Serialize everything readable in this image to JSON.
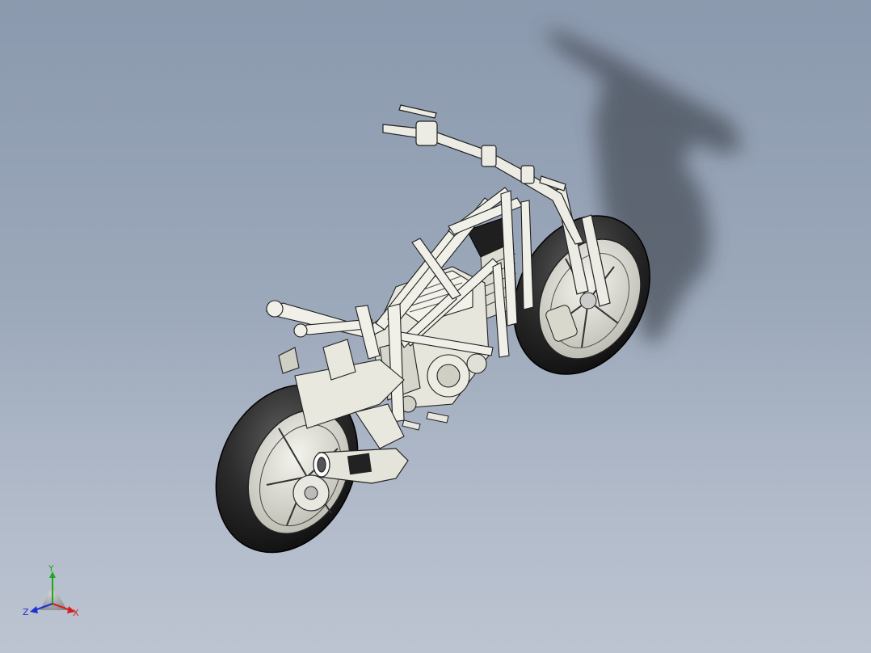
{
  "viewport": {
    "background_top": "#8b99ae",
    "background_bottom": "#bcc4d1"
  },
  "model": {
    "icon": "motorcycle-frame-model"
  },
  "triad": {
    "x_label": "X",
    "y_label": "Y",
    "z_label": "Z",
    "x_color": "#d42020",
    "y_color": "#1fa81f",
    "z_color": "#2030d0"
  }
}
